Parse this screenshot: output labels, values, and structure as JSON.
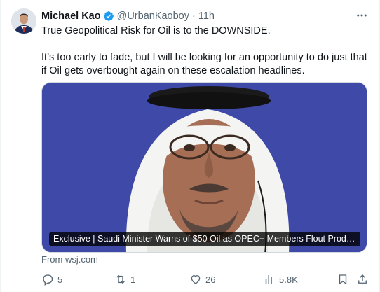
{
  "tweet": {
    "author_name": "Michael Kao",
    "handle": "@UrbanKaoboy",
    "separator": "·",
    "time": "11h",
    "text_line1": "True Geopolitical Risk for Oil is to the DOWNSIDE.",
    "text_line2": "It’s too early to fade, but I will be looking for an opportunity to do just that if Oil gets overbought again on these escalation headlines.",
    "media_caption": "Exclusive | Saudi Minister Warns of $50 Oil as OPEC+ Members Flout Producti...",
    "source": "From wsj.com"
  },
  "actions": {
    "replies": "5",
    "reposts": "1",
    "likes": "26",
    "views": "5.8K"
  },
  "colors": {
    "accent": "#1d9bf0",
    "muted": "#536471",
    "media_bg": "#3c46a4"
  },
  "icons": [
    "verified-badge-icon",
    "more-icon",
    "reply-icon",
    "repost-icon",
    "like-icon",
    "views-icon",
    "bookmark-icon",
    "share-icon"
  ]
}
